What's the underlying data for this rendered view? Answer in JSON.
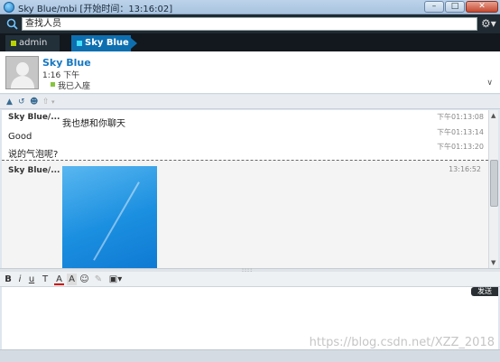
{
  "window": {
    "title": "Sky Blue/mbi  [开始时间：13:16:02]",
    "min_glyph": "–",
    "max_glyph": "□",
    "close_glyph": "✕"
  },
  "search": {
    "placeholder": "查找人员",
    "value": "查找人员"
  },
  "tabs": [
    {
      "label": "admin",
      "active": false
    },
    {
      "label": "Sky Blue",
      "active": true
    }
  ],
  "profile": {
    "name": "Sky Blue",
    "time": "1:16 下午",
    "status": "我已入座"
  },
  "messages": [
    {
      "sender": "Sky Blue/...",
      "text": "我也想和你聊天",
      "time": "下午01:13:08"
    },
    {
      "sender": "",
      "text": "Good",
      "time": "下午01:13:14"
    },
    {
      "sender": "",
      "text": "说的气泡呢?",
      "time": "下午01:13:20"
    },
    {
      "sender": "Sky Blue/...",
      "text": "",
      "time": "13:16:52",
      "has_image": true
    }
  ],
  "format_toolbar": {
    "bold": "B",
    "italic": "i",
    "underline": "u",
    "strike": "T",
    "font_color": "A",
    "font_bg": "A"
  },
  "compose": {
    "send_label": "发送"
  },
  "watermark": "https://blog.csdn.net/XZZ_2018",
  "colors": {
    "accent": "#1678c2",
    "tab_active": "#0e6fb0",
    "status_green": "#87c441"
  },
  "icons": {
    "profile_expand": "chevron-double-down-icon",
    "toolbar": [
      "org-chart-icon",
      "history-icon",
      "user-icon",
      "share-icon"
    ]
  }
}
